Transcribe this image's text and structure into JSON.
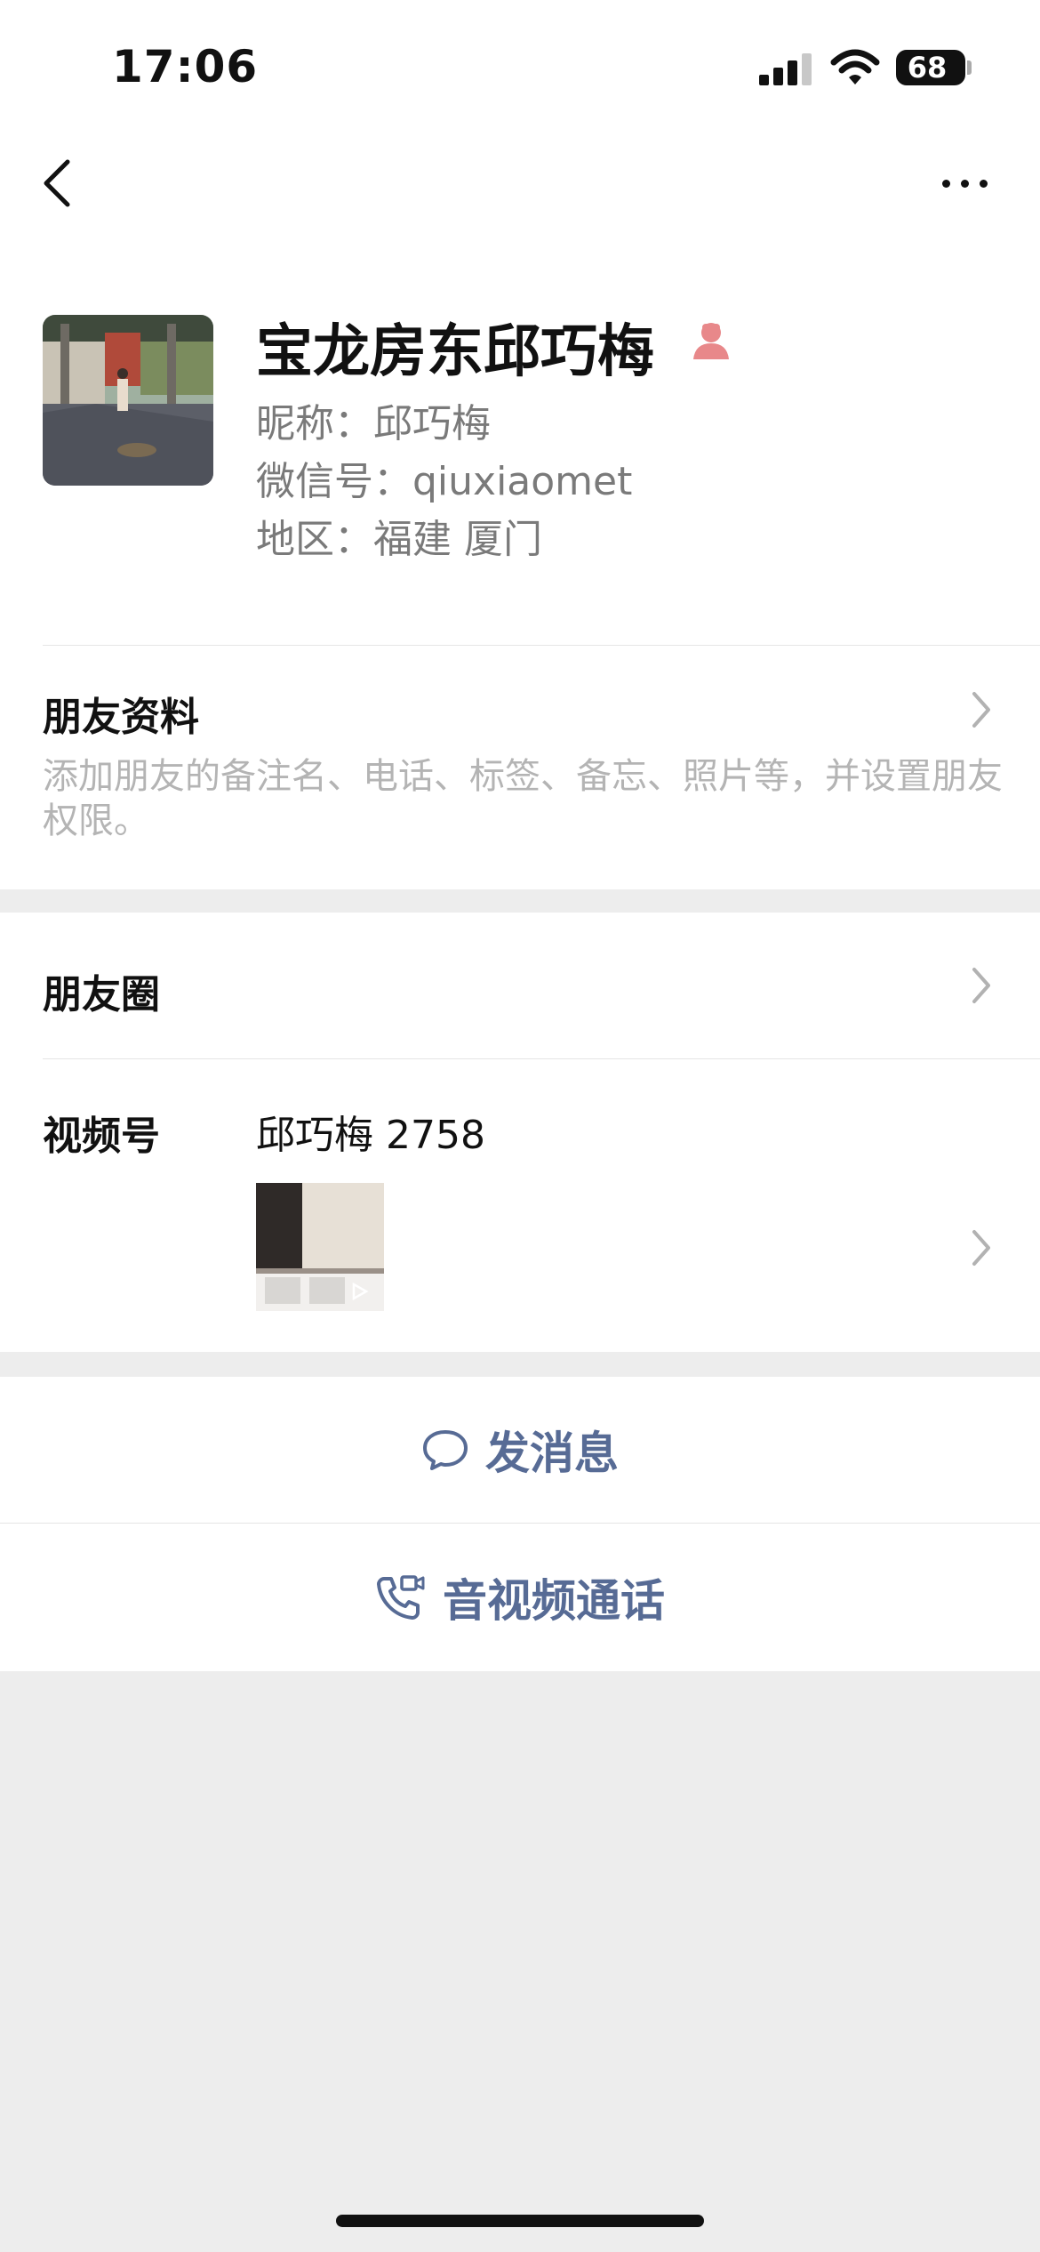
{
  "status_bar": {
    "time": "17:06",
    "battery_level": "68"
  },
  "profile": {
    "display_name": "宝龙房东邱巧梅",
    "nickname_line": "昵称：邱巧梅",
    "wechat_id_line": "微信号：qiuxiaomet",
    "region_line": "地区：福建 厦门"
  },
  "friend_info": {
    "title": "朋友资料",
    "description": "添加朋友的备注名、电话、标签、备忘、照片等，并设置朋友权限。"
  },
  "moments": {
    "title": "朋友圈"
  },
  "channels": {
    "title": "视频号",
    "channel_name": "邱巧梅 2758"
  },
  "actions": {
    "send_message": "发消息",
    "av_call": "音视频通话"
  },
  "colors": {
    "link_blue": "#576b95",
    "background_gray": "#ededed",
    "female_icon": "#e8888a"
  }
}
